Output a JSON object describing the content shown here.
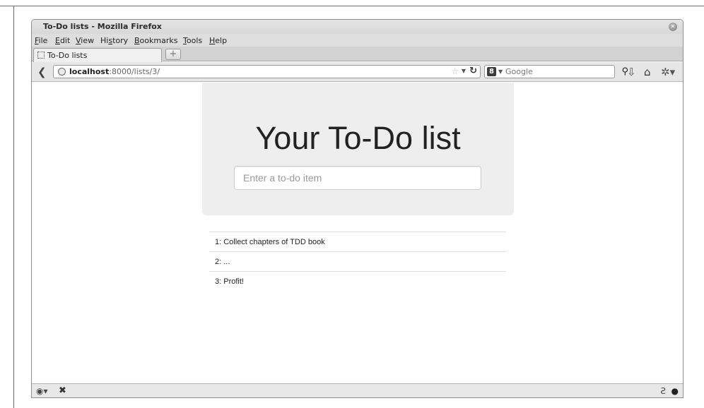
{
  "window": {
    "title": "To-Do lists - Mozilla Firefox"
  },
  "menu": {
    "items": [
      {
        "prefix": "",
        "accel": "F",
        "rest": "ile"
      },
      {
        "prefix": "",
        "accel": "E",
        "rest": "dit"
      },
      {
        "prefix": "",
        "accel": "V",
        "rest": "iew"
      },
      {
        "prefix": "Hi",
        "accel": "s",
        "rest": "tory"
      },
      {
        "prefix": "",
        "accel": "B",
        "rest": "ookmarks"
      },
      {
        "prefix": "",
        "accel": "T",
        "rest": "ools"
      },
      {
        "prefix": "",
        "accel": "H",
        "rest": "elp"
      }
    ]
  },
  "tab": {
    "label": "To-Do lists",
    "new_tab_symbol": "+"
  },
  "navbar": {
    "url_host": "localhost",
    "url_rest": ":8000/lists/3/",
    "search_engine_letter": "8",
    "search_placeholder": "Google",
    "icons": {
      "back": "back-arrow-icon",
      "search": "magnifier-icon",
      "downloads": "download-arrow-icon",
      "home": "home-icon",
      "addon": "addon-icon"
    }
  },
  "page": {
    "heading": "Your To-Do list",
    "input_placeholder": "Enter a to-do item",
    "items": [
      "1: Collect chapters of TDD book",
      "2: ...",
      "3: Profit!"
    ]
  },
  "statusbar": {
    "icons": {
      "addon_bar": "addon-bar-icon",
      "close": "close-icon",
      "sync": "sync-icon",
      "globe": "globe-icon"
    }
  },
  "colors": {
    "jumbotron_bg": "#eeeeee",
    "table_border": "#dddddd",
    "chrome_bg": "#e6e6e6"
  }
}
